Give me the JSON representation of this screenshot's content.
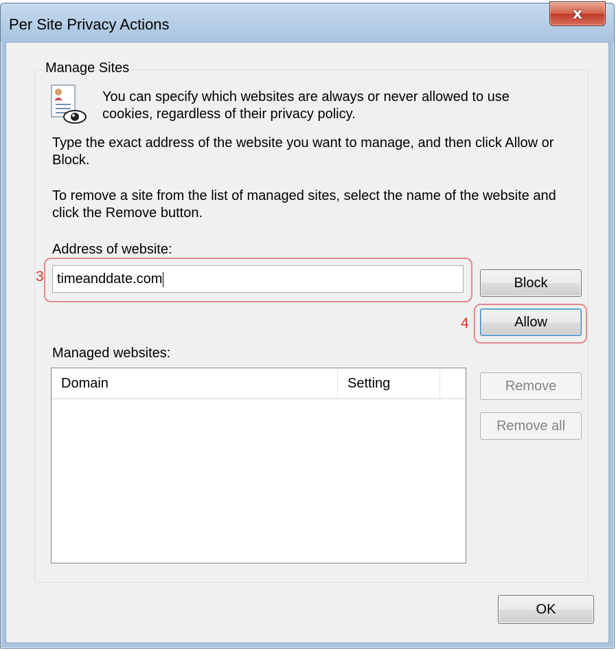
{
  "window": {
    "title": "Per Site Privacy Actions",
    "close_glyph": "x"
  },
  "manage_sites": {
    "legend": "Manage Sites",
    "icon": "privacy-document-eye-icon",
    "intro": "You can specify which websites are always or never allowed to use cookies, regardless of their privacy policy.",
    "instruction_1": "Type the exact address of the website you want to manage, and then click Allow or Block.",
    "instruction_2": "To remove a site from the list of managed sites, select the name of the website and click the Remove button."
  },
  "address": {
    "label": "Address of website:",
    "value": "timeanddate.com"
  },
  "annotations": {
    "step_3": "3",
    "step_4": "4",
    "color": "#e03226"
  },
  "buttons": {
    "block": "Block",
    "allow": "Allow",
    "remove": "Remove",
    "remove_all": "Remove all",
    "ok": "OK"
  },
  "managed": {
    "label": "Managed websites:",
    "columns": [
      "Domain",
      "Setting"
    ],
    "rows": []
  }
}
